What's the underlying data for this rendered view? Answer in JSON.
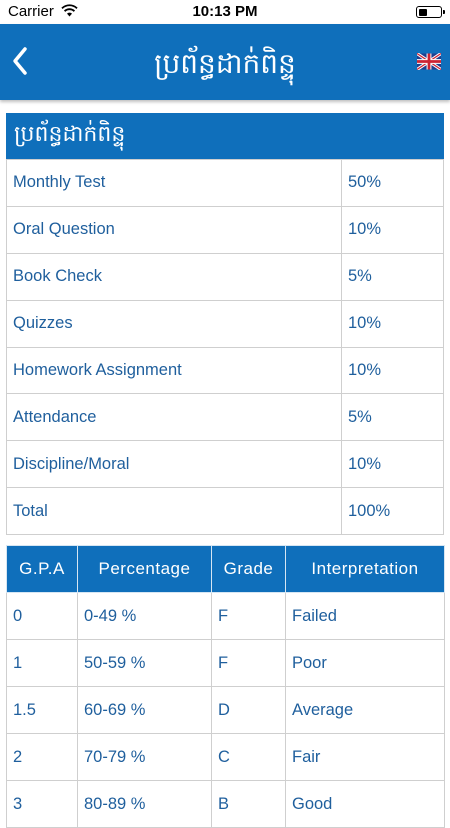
{
  "status": {
    "carrier": "Carrier",
    "time": "10:13 PM"
  },
  "nav": {
    "title": "ប្រព័ន្ធដាក់ពិន្ទុ",
    "back_icon": "chevron-left-icon",
    "language_icon": "uk-flag-icon"
  },
  "weights": {
    "header": "ប្រព័ន្ធដាក់ពិន្ទុ",
    "rows": [
      {
        "label": "Monthly Test",
        "value": "50%"
      },
      {
        "label": "Oral Question",
        "value": "10%"
      },
      {
        "label": "Book Check",
        "value": "5%"
      },
      {
        "label": "Quizzes",
        "value": "10%"
      },
      {
        "label": "Homework Assignment",
        "value": "10%"
      },
      {
        "label": "Attendance",
        "value": "5%"
      },
      {
        "label": "Discipline/Moral",
        "value": "10%"
      },
      {
        "label": "Total",
        "value": "100%"
      }
    ]
  },
  "gpa": {
    "headers": [
      "G.P.A",
      "Percentage",
      "Grade",
      "Interpretation"
    ],
    "rows": [
      [
        "0",
        "0-49 %",
        "F",
        "Failed"
      ],
      [
        "1",
        "50-59 %",
        "F",
        "Poor"
      ],
      [
        "1.5",
        "60-69 %",
        "D",
        "Average"
      ],
      [
        "2",
        "70-79 %",
        "C",
        "Fair"
      ],
      [
        "3",
        "80-89 %",
        "B",
        "Good"
      ]
    ]
  },
  "colors": {
    "primary": "#0f6fbb",
    "cell_text": "#1f5f9d",
    "border": "#cfcfcf"
  }
}
